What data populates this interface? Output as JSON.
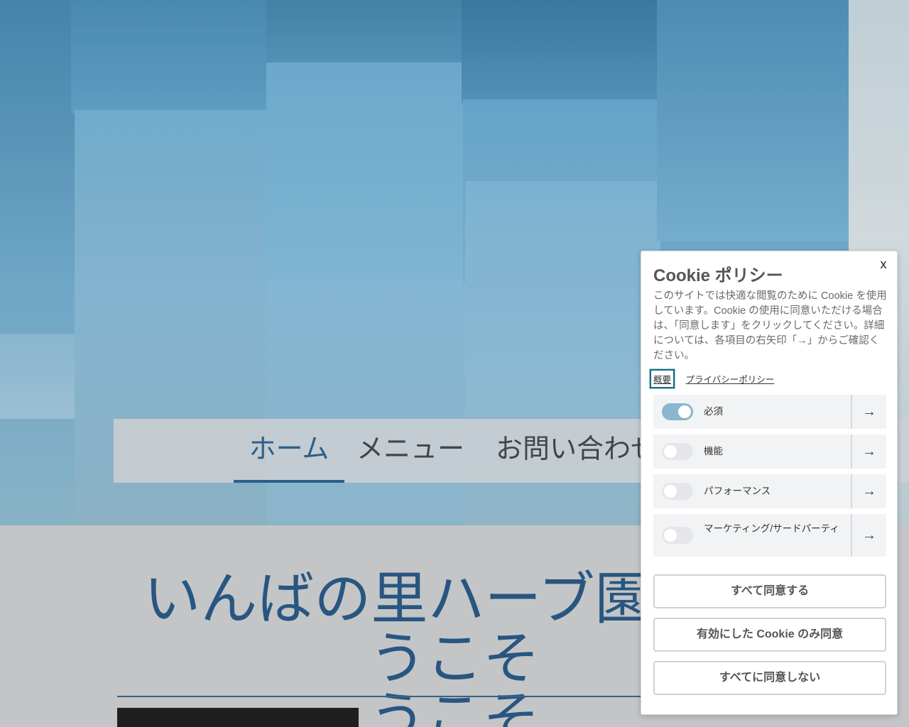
{
  "nav": {
    "items": [
      {
        "label": "ホーム",
        "active": true
      },
      {
        "label": "メニュー",
        "active": false
      },
      {
        "label": "お問い合わせ",
        "active": false
      }
    ]
  },
  "main": {
    "title_line1": "いんばの里ハーブ園へようこそ",
    "title_line2": "うこそ"
  },
  "cookie": {
    "close_label": "x",
    "title": "Cookie ポリシー",
    "description": "このサイトでは快適な閲覧のために Cookie を使用しています。Cookie の使用に同意いただける場合は、「同意します」をクリックしてください。詳細については、各項目の右矢印「→」からご確認ください。",
    "tabs": [
      "概要",
      "プライバシーポリシー"
    ],
    "categories": [
      {
        "label": "必須",
        "enabled": true
      },
      {
        "label": "機能",
        "enabled": false
      },
      {
        "label": "パフォーマンス",
        "enabled": false
      },
      {
        "label": "マーケティング/サードパーティ",
        "enabled": false
      }
    ],
    "buttons": {
      "accept_all": "すべて同意する",
      "accept_enabled": "有効にした Cookie のみ同意",
      "reject_all": "すべてに同意しない"
    },
    "arrow_icon": "arrow-right-icon"
  },
  "colors": {
    "accent": "#1b5a8c",
    "toggle_on": "#8ab6ce"
  }
}
